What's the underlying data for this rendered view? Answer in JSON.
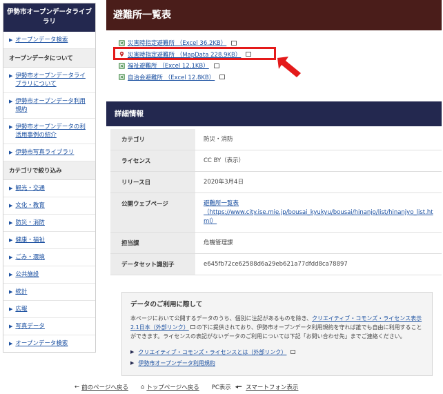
{
  "sidebar": {
    "title": "伊勢市オープンデータライブラリ",
    "top_link": "オープンデータ検索",
    "about_heading": "オープンデータについて",
    "about_links": [
      "伊勢市オープンデータライブラリについて",
      "伊勢市オープンデータ利用規約",
      "伊勢市オープンデータの利活用事例の紹介",
      "伊勢市写真ライブラリ"
    ],
    "category_heading": "カテゴリで絞り込み",
    "category_links": [
      "観光・交通",
      "文化・教育",
      "防災・消防",
      "健康・福祉",
      "ごみ・環境",
      "公共施設",
      "統計",
      "広報",
      "写真データ",
      "オープンデータ検索"
    ]
  },
  "main": {
    "page_title": "避難所一覧表",
    "resources": [
      {
        "label": "災害時指定避難所 （Excel 36.2KB）",
        "icon": "excel-icon"
      },
      {
        "label": "災害時指定避難所 （MapData 228.9KB）",
        "icon": "map-pin-icon"
      },
      {
        "label": "福祉避難所 （Excel 12.1KB）",
        "icon": "excel-icon"
      },
      {
        "label": "自治会避難所 （Excel 12.8KB）",
        "icon": "excel-icon"
      }
    ],
    "details_heading": "詳細情報",
    "details": [
      {
        "key": "カテゴリ",
        "value": "防災・消防",
        "is_link": false
      },
      {
        "key": "ライセンス",
        "value": "CC BY（表示）",
        "is_link": false
      },
      {
        "key": "リリース日",
        "value": "2020年3月4日",
        "is_link": false
      },
      {
        "key": "公開ウェブページ",
        "value": "避難所一覧表\n（https://www.city.ise.mie.jp/bousai_kyukyu/bousai/hinanjo/list/hinanjyo_list.html）",
        "is_link": true
      },
      {
        "key": "担当課",
        "value": "危機管理課",
        "is_link": false
      },
      {
        "key": "データセット識別子",
        "value": "e645fb72ce62588d6a29eb621a77dfdd8ca78897",
        "is_link": false
      }
    ],
    "usage": {
      "title": "データのご利用に際して",
      "body_1": "本ページにおいて公開するデータのうち、個別に注記があるものを除き、",
      "body_link": "クリエイティブ・コモンズ・ライセンス表示2.1日本（外部リンク）",
      "body_2": "の下に提供されており、伊勢市オープンデータ利用規約を守れば誰でも自由に利用することができます。ライセンスの表記がないデータのご利用については下記「お問い合わせ先」までご連絡ください。",
      "links": [
        "クリエイティブ・コモンズ・ライセンスとは（外部リンク）",
        "伊勢市オープンデータ利用規約"
      ]
    }
  },
  "footer": {
    "back": "前のページへ戻る",
    "top": "トップページへ戻る",
    "pc": "PC表示",
    "smartphone": "スマートフォン表示"
  },
  "colors": {
    "sidebar_header": "#23284f",
    "page_header": "#4a1d1a",
    "highlight": "#e41a1a",
    "link": "#1a4fa0"
  }
}
